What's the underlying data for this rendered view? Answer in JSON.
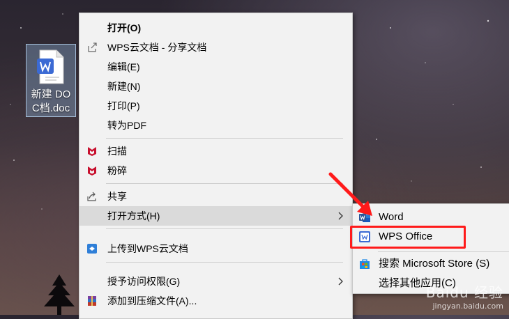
{
  "desktop": {
    "file_label": "新建 DOC档.doc",
    "file_icon": "wps-word-doc-icon"
  },
  "menu": {
    "items": [
      {
        "label": "打开(O)",
        "icon": ""
      },
      {
        "label": "WPS云文档 - 分享文档",
        "icon": "share-out-icon"
      },
      {
        "label": "编辑(E)",
        "icon": ""
      },
      {
        "label": "新建(N)",
        "icon": ""
      },
      {
        "label": "打印(P)",
        "icon": ""
      },
      {
        "label": "转为PDF",
        "icon": ""
      },
      {
        "label": "扫描",
        "icon": "mcafee-icon"
      },
      {
        "label": "粉碎",
        "icon": "mcafee-icon"
      },
      {
        "label": "共享",
        "icon": "share-icon"
      },
      {
        "label": "打开方式(H)",
        "icon": ""
      },
      {
        "label": "上传到WPS云文档",
        "icon": "wps-cloud-icon"
      },
      {
        "label": "授予访问权限(G)",
        "icon": ""
      },
      {
        "label": "添加到压缩文件(A)...",
        "icon": "winrar-icon"
      }
    ]
  },
  "submenu": {
    "items": [
      {
        "label": "Word",
        "icon": "word-icon"
      },
      {
        "label": "WPS Office",
        "icon": "wps-office-icon"
      },
      {
        "label": "搜索 Microsoft Store (S)",
        "icon": "microsoft-store-icon"
      },
      {
        "label": "选择其他应用(C)",
        "icon": ""
      }
    ]
  },
  "colors": {
    "highlight": "#ff1a1a",
    "menu_bg": "#f2f2f2",
    "hover_bg": "#dadada",
    "mcafee_red": "#c8102e",
    "word_blue": "#2b579a",
    "wps_blue": "#3b6ad4"
  },
  "watermark": {
    "brand": "Baidu 经验",
    "url": "jingyan.baidu.com"
  }
}
